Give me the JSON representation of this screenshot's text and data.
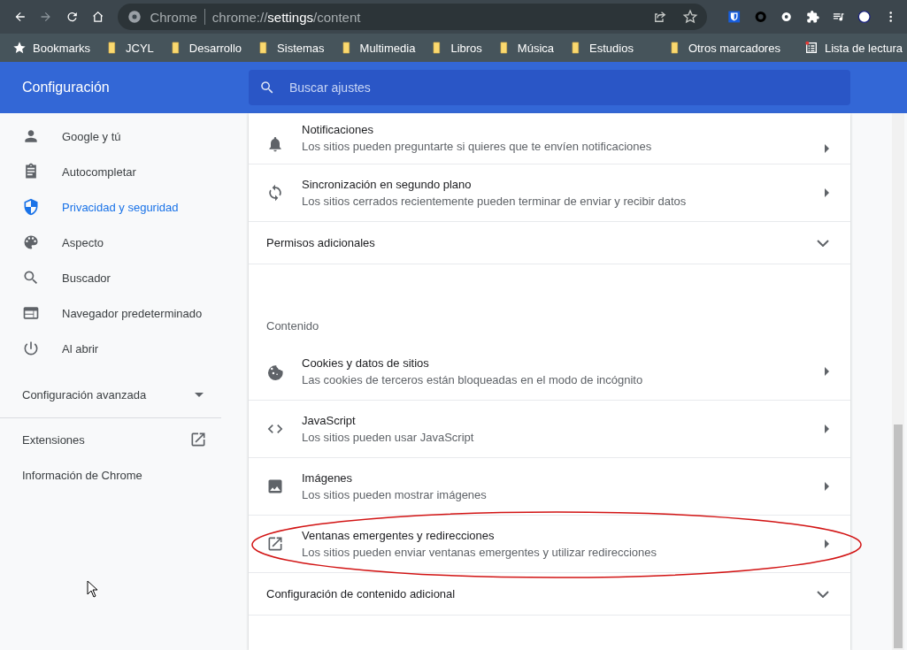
{
  "toolbar": {
    "site_label": "Chrome",
    "url_host": "chrome://",
    "url_bold": "settings",
    "url_path": "/content"
  },
  "bookmarks": [
    {
      "label": "Bookmarks",
      "kind": "star"
    },
    {
      "label": "JCYL",
      "kind": "folder"
    },
    {
      "label": "Desarrollo",
      "kind": "folder"
    },
    {
      "label": "Sistemas",
      "kind": "folder"
    },
    {
      "label": "Multimedia",
      "kind": "folder"
    },
    {
      "label": "Libros",
      "kind": "folder"
    },
    {
      "label": "Música",
      "kind": "folder"
    },
    {
      "label": "Estudios",
      "kind": "folder"
    }
  ],
  "bookmarks_right": [
    {
      "label": "Otros marcadores",
      "kind": "folder"
    },
    {
      "label": "Lista de lectura",
      "kind": "reading"
    }
  ],
  "header": {
    "title": "Configuración",
    "search_placeholder": "Buscar ajustes"
  },
  "sidebar": {
    "items": [
      {
        "label": "Google y tú",
        "selected": false
      },
      {
        "label": "Autocompletar",
        "selected": false
      },
      {
        "label": "Privacidad y seguridad",
        "selected": true
      },
      {
        "label": "Aspecto",
        "selected": false
      },
      {
        "label": "Buscador",
        "selected": false
      },
      {
        "label": "Navegador predeterminado",
        "selected": false
      },
      {
        "label": "Al abrir",
        "selected": false
      }
    ],
    "advanced": {
      "label": "Configuración avanzada",
      "expanded": false
    },
    "links": [
      {
        "label": "Extensiones"
      },
      {
        "label": "Información de Chrome"
      }
    ]
  },
  "content": [
    {
      "kind": "link",
      "title": "Notificaciones",
      "subtitle": "Los sitios pueden preguntarte si quieres que te envíen notificaciones",
      "highlighted": false
    },
    {
      "kind": "link",
      "title": "Sincronización en segundo plano",
      "subtitle": "Los sitios cerrados recientemente pueden terminar de enviar y recibir datos",
      "highlighted": false
    },
    {
      "kind": "expander",
      "title": "Permisos adicionales",
      "expanded": false
    },
    {
      "kind": "heading",
      "title": "Contenido"
    },
    {
      "kind": "link",
      "title": "Cookies y datos de sitios",
      "subtitle": "Las cookies de terceros están bloqueadas en el modo de incógnito",
      "highlighted": false
    },
    {
      "kind": "link",
      "title": "JavaScript",
      "subtitle": "Los sitios pueden usar JavaScript",
      "highlighted": false
    },
    {
      "kind": "link",
      "title": "Imágenes",
      "subtitle": "Los sitios pueden mostrar imágenes",
      "highlighted": false
    },
    {
      "kind": "link",
      "title": "Ventanas emergentes y redirecciones",
      "subtitle": "Los sitios pueden enviar ventanas emergentes y utilizar redirecciones",
      "highlighted": true
    },
    {
      "kind": "expander",
      "title": "Configuración de contenido adicional",
      "expanded": false
    }
  ]
}
